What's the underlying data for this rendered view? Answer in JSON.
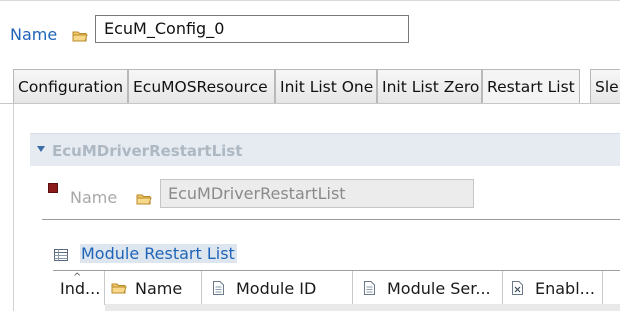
{
  "header": {
    "name_label": "Name",
    "name_value": "EcuM_Config_0"
  },
  "tabs": [
    {
      "label": "Configuration",
      "active": false
    },
    {
      "label": "EcuMOSResource",
      "active": false
    },
    {
      "label": "Init List One",
      "active": false
    },
    {
      "label": "Init List Zero",
      "active": false
    },
    {
      "label": "Restart List",
      "active": true
    },
    {
      "label": "Sle",
      "active": false
    }
  ],
  "section": {
    "title": "EcuMDriverRestartList",
    "name_label": "Name",
    "name_value": "EcuMDriverRestartList"
  },
  "table": {
    "title": "Module Restart List",
    "columns": [
      "Ind...",
      "Name",
      "Module ID",
      "Module Ser...",
      "Enabl..."
    ]
  },
  "colors": {
    "accent": "#1f64b8",
    "section_bg": "#e5ebf1"
  },
  "icons": [
    "folder-icon",
    "table-icon",
    "document-icon",
    "checkbox-icon",
    "collapse-caret-icon",
    "required-marker-icon"
  ]
}
